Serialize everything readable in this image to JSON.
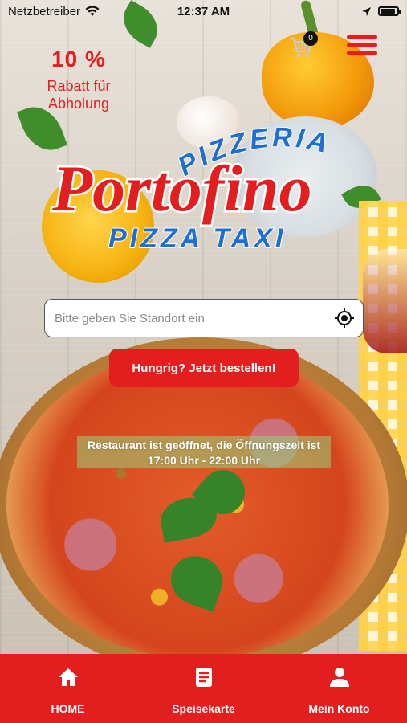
{
  "statusbar": {
    "carrier": "Netzbetreiber",
    "time": "12:37 AM"
  },
  "discount": {
    "percent": "10 %",
    "text": "Rabatt für Abholung"
  },
  "cart": {
    "count": "0"
  },
  "logo": {
    "top": "PIZZERIA",
    "main": "Portofino",
    "bottom": "PIZZA TAXI"
  },
  "search": {
    "placeholder": "Bitte geben Sie Standort ein"
  },
  "order_button": {
    "label": "Hungrig? Jetzt bestellen!"
  },
  "status_banner": {
    "text": "Restaurant ist geöffnet, die Öffnungszeit ist 17:00 Uhr - 22:00 Uhr"
  },
  "bottom_nav": {
    "items": [
      {
        "label": "HOME",
        "icon": "home-icon"
      },
      {
        "label": "Speisekarte",
        "icon": "menu-card-icon"
      },
      {
        "label": "Mein Konto",
        "icon": "user-icon"
      }
    ]
  },
  "colors": {
    "brand_red": "#e31e1e",
    "logo_blue": "#1f6fd1",
    "status_green": "#96d278"
  }
}
